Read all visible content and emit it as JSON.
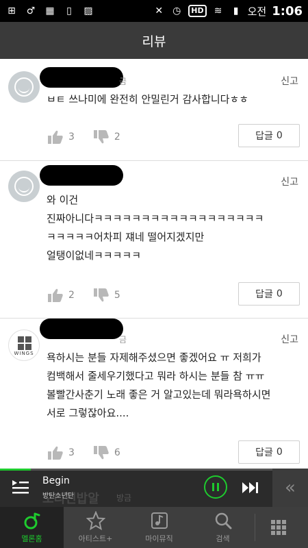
{
  "status_bar": {
    "icons_left": [
      "plus-box-icon",
      "male-icon",
      "calendar-icon",
      "phone-icon",
      "image-icon"
    ],
    "icons_right": [
      "mute-icon",
      "alarm-icon",
      "hd-icon",
      "wifi-icon",
      "signal-icon",
      "battery-icon"
    ],
    "hd_label": "HD",
    "ampm": "오전",
    "time": "1:06"
  },
  "title": "리뷰",
  "comments": [
    {
      "name_tail": "금",
      "report_label": "신고",
      "lines": [
        "ㅂㅌ 쓰나미에 완전히 안밀린거 감사합니다ㅎㅎ"
      ],
      "likes": "3",
      "dislikes": "2",
      "reply_label": "답글",
      "reply_count": "0",
      "avatar": "default"
    },
    {
      "name_tail": "",
      "report_label": "신고",
      "lines": [
        "와 이건",
        "진짜아니다ㅋㅋㅋㅋㅋㅋㅋㅋㅋㅋㅋㅋㅋㅋㅋㅋㅋㅋ",
        "ㅋㅋㅋㅋㅋ어차피 쟤네 떨어지겠지만",
        "얼탱이없네ㅋㅋㅋㅋㅋ"
      ],
      "likes": "2",
      "dislikes": "5",
      "reply_label": "답글",
      "reply_count": "0",
      "avatar": "default"
    },
    {
      "name_tail": "금",
      "report_label": "신고",
      "lines": [
        "욕하시는 분들 자제해주셨으면 좋겠어요 ㅠ 저희가",
        "컴백해서 줄세우기했다고 뭐라 하시는 분들 참 ㅠㅠ",
        "볼빨간사춘기 노래 좋은 거 알고있는데 뭐라욕하시면",
        "서로 그렇잖아요...."
      ],
      "likes": "3",
      "dislikes": "6",
      "reply_label": "답글",
      "reply_count": "0",
      "avatar": "wings",
      "avatar_text": "WINGS"
    }
  ],
  "player": {
    "song": "Begin",
    "artist": "방탄소년단",
    "ghost_text": "오리진밥알",
    "ghost_tag": "방금",
    "progress": 0.1
  },
  "tabs": [
    {
      "label": "멜론홈",
      "icon": "melon-home-icon",
      "active": true
    },
    {
      "label": "아티스트+",
      "icon": "star-icon",
      "active": false
    },
    {
      "label": "마이뮤직",
      "icon": "music-note-icon",
      "active": false
    },
    {
      "label": "검색",
      "icon": "search-icon",
      "active": false
    },
    {
      "label": "",
      "icon": "grid-menu-icon",
      "active": false
    }
  ],
  "colors": {
    "accent": "#1ecb2e",
    "title_bar": "#3a3a3a",
    "tab_bar": "#3e3e3e"
  }
}
